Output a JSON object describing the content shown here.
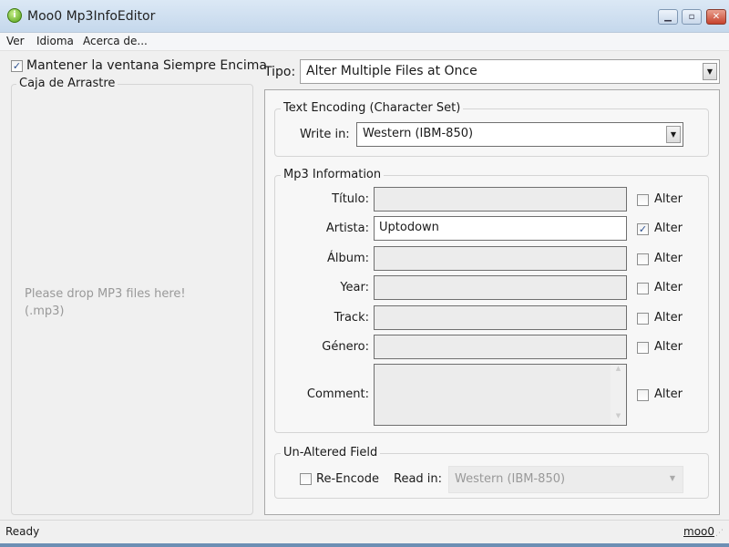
{
  "window": {
    "title": "Moo0 Mp3InfoEditor",
    "app_icon": "i",
    "minimize": "minimize-icon",
    "maximize": "maximize-icon",
    "close": "close-icon"
  },
  "menu": [
    "Ver",
    "Idioma",
    "Acerca de..."
  ],
  "left": {
    "always_on_top_label": "Mantener la ventana Siempre Encima",
    "always_on_top_checked": true,
    "drop_group": "Caja de Arrastre",
    "drop_hint_1": "Please drop MP3 files here!",
    "drop_hint_2": "(.mp3)"
  },
  "right": {
    "tipo_label": "Tipo:",
    "tipo_value": "Alter Multiple Files at Once",
    "encoding": {
      "group": "Text Encoding (Character Set)",
      "write_label": "Write in:",
      "write_value": "Western (IBM-850)"
    },
    "info": {
      "group": "Mp3 Information",
      "alter_label": "Alter",
      "fields": [
        {
          "label": "Título:",
          "value": "",
          "alter": false
        },
        {
          "label": "Artista:",
          "value": "Uptodown",
          "alter": true
        },
        {
          "label": "Álbum:",
          "value": "",
          "alter": false
        },
        {
          "label": "Year:",
          "value": "",
          "alter": false
        },
        {
          "label": "Track:",
          "value": "",
          "alter": false
        },
        {
          "label": "Género:",
          "value": "",
          "alter": false
        },
        {
          "label": "Comment:",
          "value": "",
          "alter": false
        }
      ]
    },
    "unaltered": {
      "group": "Un-Altered Field",
      "reencode_label": "Re-Encode",
      "reencode_checked": false,
      "read_label": "Read in:",
      "read_value": "Western (IBM-850)"
    }
  },
  "status": {
    "text": "Ready",
    "link": "moo0"
  }
}
